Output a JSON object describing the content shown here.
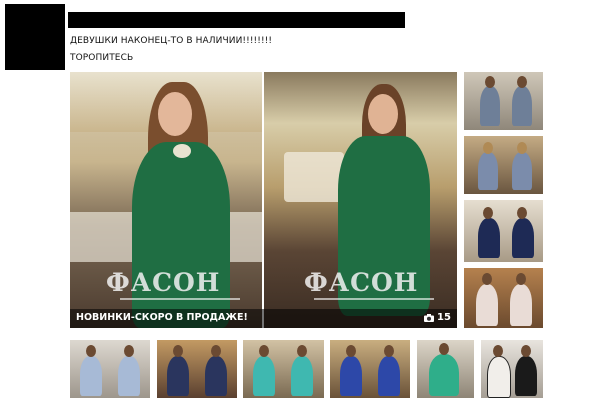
{
  "post": {
    "text_line1": "ДЕВУШКИ НАКОНЕЦ-ТО В НАЛИЧИИ!!!!!!!!",
    "text_line2": "ТОРОПИТЕСЬ"
  },
  "gallery": {
    "caption": "НОВИНКИ-СКОРО В ПРОДАЖЕ!",
    "photo_count": "15",
    "brand": "ФАСОН"
  },
  "colors": {
    "dress_green": "#1f6e43",
    "room_warm": "#c9b48a"
  },
  "icons": [
    "camera-icon"
  ]
}
